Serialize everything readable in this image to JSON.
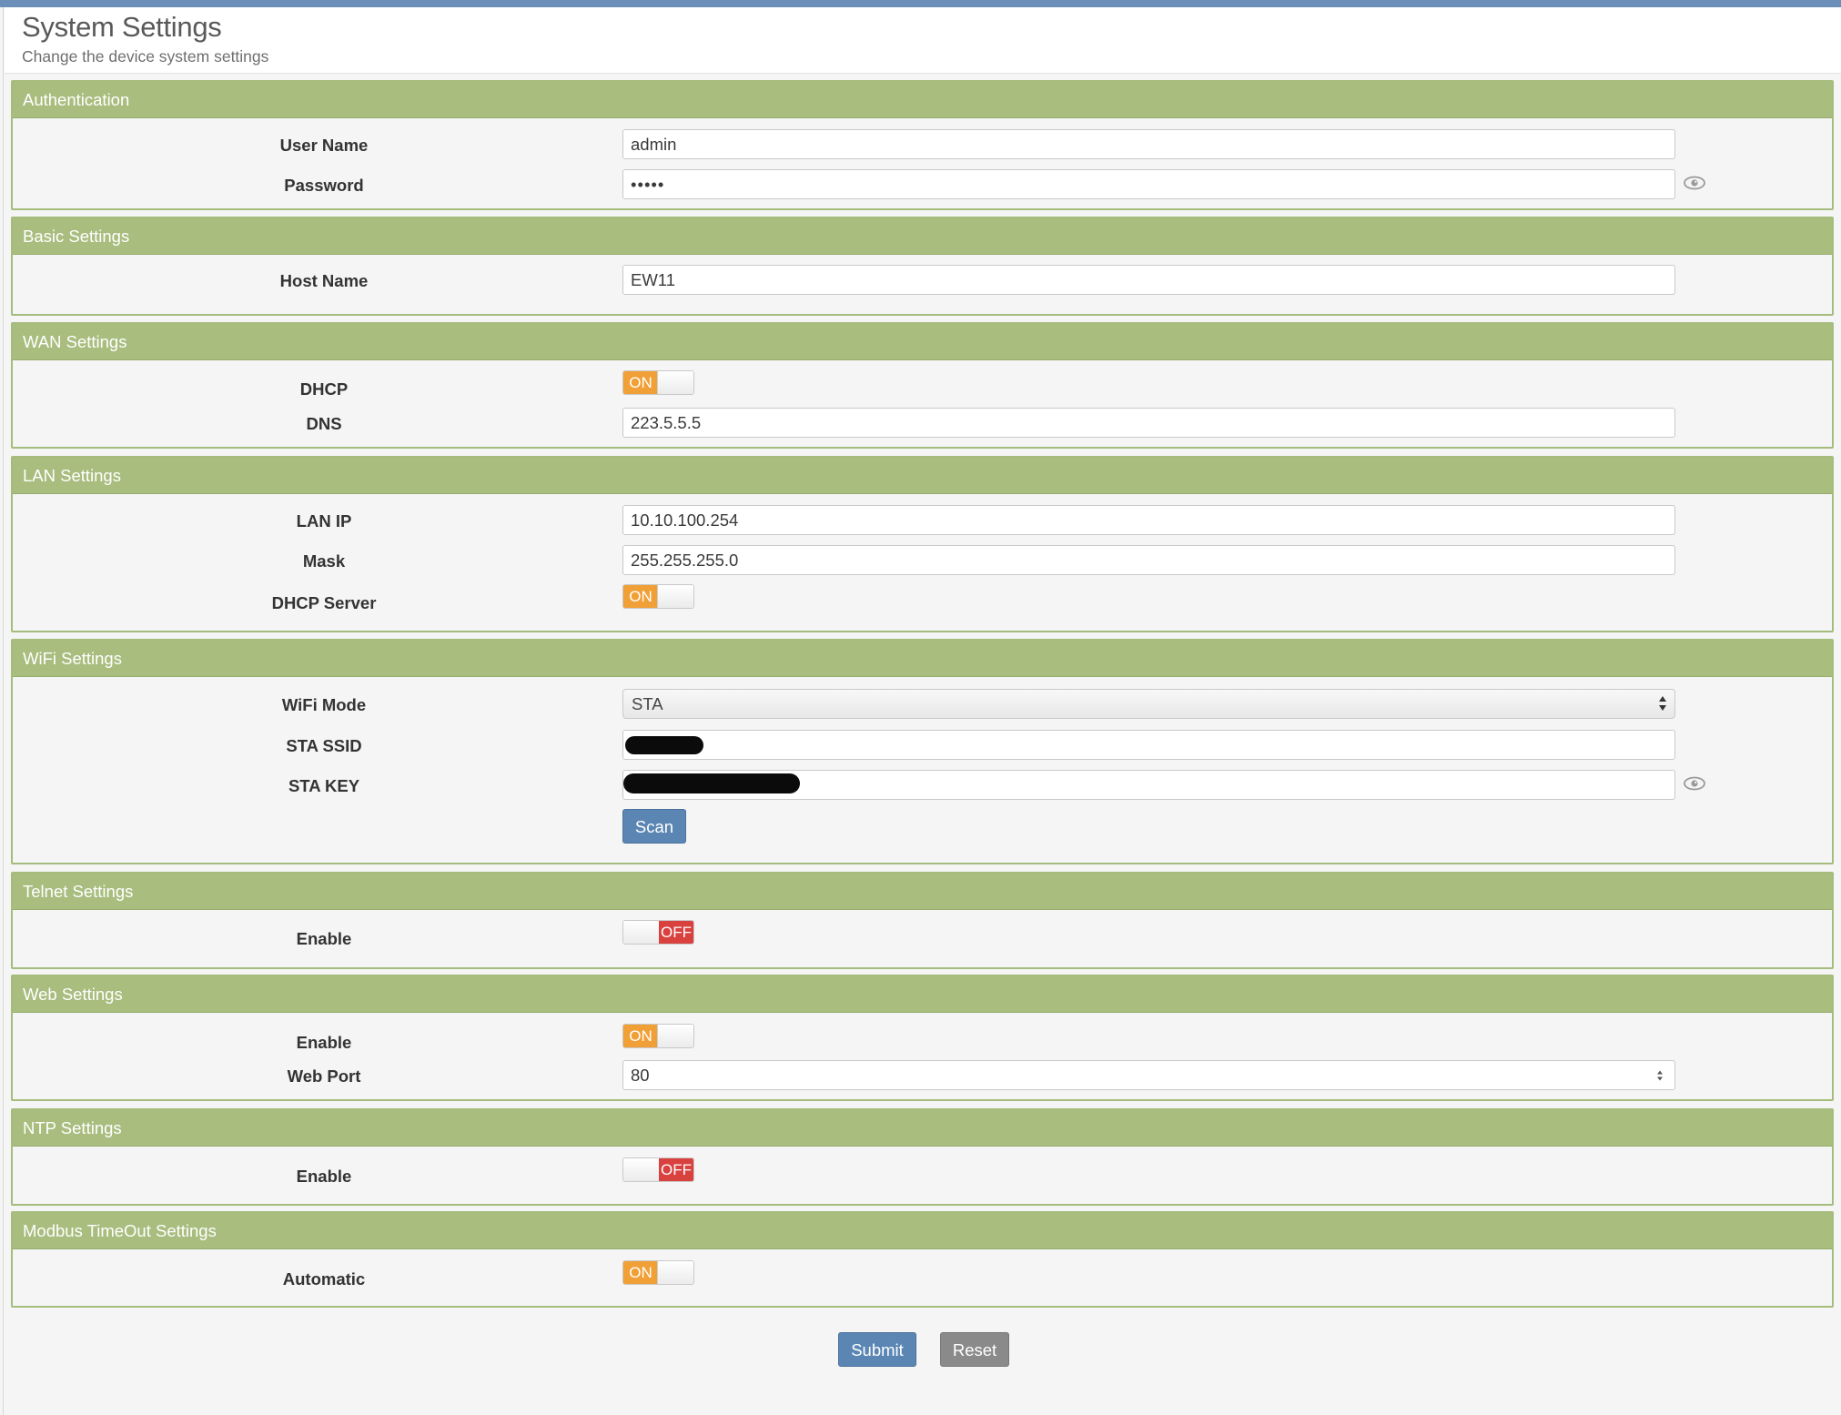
{
  "page": {
    "title": "System Settings",
    "subtitle": "Change the device system settings"
  },
  "authentication": {
    "heading": "Authentication",
    "username_label": "User Name",
    "username_value": "admin",
    "password_label": "Password",
    "password_value": "•••••"
  },
  "basic": {
    "heading": "Basic Settings",
    "hostname_label": "Host Name",
    "hostname_value": "EW11"
  },
  "wan": {
    "heading": "WAN Settings",
    "dhcp_label": "DHCP",
    "dhcp_state": "ON",
    "dns_label": "DNS",
    "dns_value": "223.5.5.5"
  },
  "lan": {
    "heading": "LAN Settings",
    "ip_label": "LAN IP",
    "ip_value": "10.10.100.254",
    "mask_label": "Mask",
    "mask_value": "255.255.255.0",
    "dhcp_server_label": "DHCP Server",
    "dhcp_server_state": "ON"
  },
  "wifi": {
    "heading": "WiFi Settings",
    "mode_label": "WiFi Mode",
    "mode_value": "STA",
    "ssid_label": "STA SSID",
    "key_label": "STA KEY",
    "scan_label": "Scan"
  },
  "telnet": {
    "heading": "Telnet Settings",
    "enable_label": "Enable",
    "enable_state": "OFF"
  },
  "web": {
    "heading": "Web Settings",
    "enable_label": "Enable",
    "enable_state": "ON",
    "port_label": "Web Port",
    "port_value": "80"
  },
  "ntp": {
    "heading": "NTP Settings",
    "enable_label": "Enable",
    "enable_state": "OFF"
  },
  "modbus": {
    "heading": "Modbus TimeOut Settings",
    "automatic_label": "Automatic",
    "automatic_state": "ON"
  },
  "actions": {
    "submit_label": "Submit",
    "reset_label": "Reset"
  },
  "colors": {
    "panel_header": "#a8bd7e",
    "toggle_on": "#f0a036",
    "toggle_off": "#d9413f",
    "primary_button": "#5b86b4",
    "secondary_button": "#8a8a8a"
  },
  "icons": {
    "password_reveal": "eye-icon",
    "select_caret": "chevron-updown-icon"
  }
}
